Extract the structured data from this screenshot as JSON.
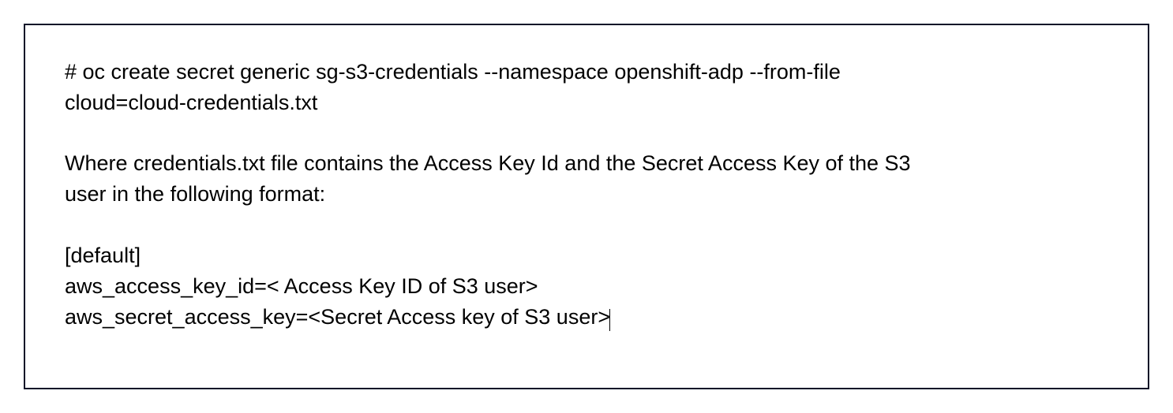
{
  "doc": {
    "command_line1": "# oc create secret generic sg-s3-credentials --namespace openshift-adp --from-file",
    "command_line2": "cloud=cloud-credentials.txt",
    "explain_line1": "Where credentials.txt file contains the Access Key Id and the Secret Access Key of the S3",
    "explain_line2": "user in the following format:",
    "cfg_line1": "[default]",
    "cfg_line2": "aws_access_key_id=< Access Key ID of S3 user>",
    "cfg_line3": "aws_secret_access_key=<Secret Access key of S3 user>"
  }
}
